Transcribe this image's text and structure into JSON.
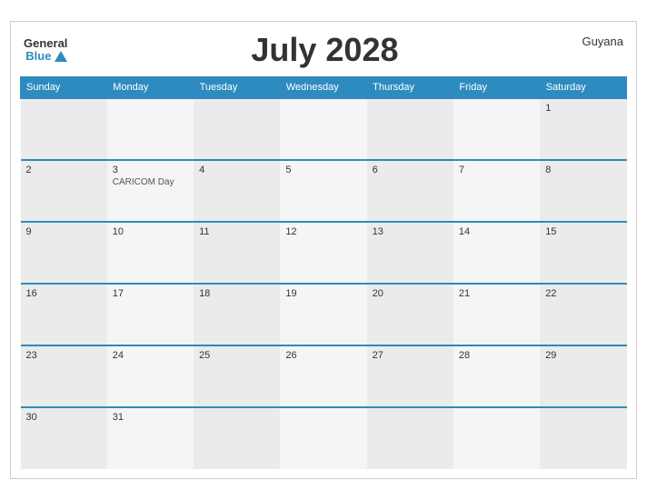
{
  "header": {
    "logo_general": "General",
    "logo_blue": "Blue",
    "title": "July 2028",
    "country": "Guyana"
  },
  "weekdays": [
    "Sunday",
    "Monday",
    "Tuesday",
    "Wednesday",
    "Thursday",
    "Friday",
    "Saturday"
  ],
  "weeks": [
    [
      {
        "day": "",
        "event": ""
      },
      {
        "day": "",
        "event": ""
      },
      {
        "day": "",
        "event": ""
      },
      {
        "day": "",
        "event": ""
      },
      {
        "day": "",
        "event": ""
      },
      {
        "day": "",
        "event": ""
      },
      {
        "day": "1",
        "event": ""
      }
    ],
    [
      {
        "day": "2",
        "event": ""
      },
      {
        "day": "3",
        "event": "CARICOM Day"
      },
      {
        "day": "4",
        "event": ""
      },
      {
        "day": "5",
        "event": ""
      },
      {
        "day": "6",
        "event": ""
      },
      {
        "day": "7",
        "event": ""
      },
      {
        "day": "8",
        "event": ""
      }
    ],
    [
      {
        "day": "9",
        "event": ""
      },
      {
        "day": "10",
        "event": ""
      },
      {
        "day": "11",
        "event": ""
      },
      {
        "day": "12",
        "event": ""
      },
      {
        "day": "13",
        "event": ""
      },
      {
        "day": "14",
        "event": ""
      },
      {
        "day": "15",
        "event": ""
      }
    ],
    [
      {
        "day": "16",
        "event": ""
      },
      {
        "day": "17",
        "event": ""
      },
      {
        "day": "18",
        "event": ""
      },
      {
        "day": "19",
        "event": ""
      },
      {
        "day": "20",
        "event": ""
      },
      {
        "day": "21",
        "event": ""
      },
      {
        "day": "22",
        "event": ""
      }
    ],
    [
      {
        "day": "23",
        "event": ""
      },
      {
        "day": "24",
        "event": ""
      },
      {
        "day": "25",
        "event": ""
      },
      {
        "day": "26",
        "event": ""
      },
      {
        "day": "27",
        "event": ""
      },
      {
        "day": "28",
        "event": ""
      },
      {
        "day": "29",
        "event": ""
      }
    ],
    [
      {
        "day": "30",
        "event": ""
      },
      {
        "day": "31",
        "event": ""
      },
      {
        "day": "",
        "event": ""
      },
      {
        "day": "",
        "event": ""
      },
      {
        "day": "",
        "event": ""
      },
      {
        "day": "",
        "event": ""
      },
      {
        "day": "",
        "event": ""
      }
    ]
  ]
}
